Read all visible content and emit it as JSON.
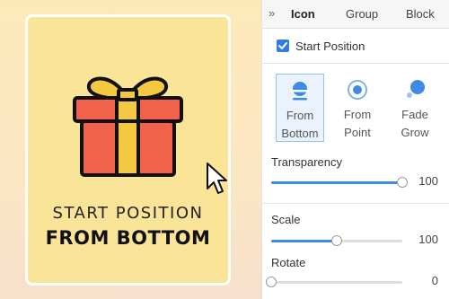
{
  "canvas": {
    "caption_line1": "START POSITION",
    "caption_line2": "FROM BOTTOM"
  },
  "panel": {
    "collapse_glyph": "»",
    "tabs": [
      {
        "label": "Icon",
        "active": true
      },
      {
        "label": "Group",
        "active": false
      },
      {
        "label": "Block",
        "active": false
      }
    ],
    "start_position": {
      "label": "Start Position",
      "checked": true
    },
    "options": [
      {
        "line1": "From",
        "line2": "Bottom",
        "icon": "from-bottom-icon",
        "selected": true
      },
      {
        "line1": "From",
        "line2": "Point",
        "icon": "from-point-icon",
        "selected": false
      },
      {
        "line1": "Fade",
        "line2": "Grow",
        "icon": "fade-grow-icon",
        "selected": false
      }
    ],
    "sliders": {
      "transparency": {
        "label": "Transparency",
        "value": "100",
        "fraction": 1.0
      },
      "scale": {
        "label": "Scale",
        "value": "100",
        "fraction": 0.5
      },
      "rotate": {
        "label": "Rotate",
        "value": "0",
        "fraction": 0.0
      }
    }
  },
  "colors": {
    "accent": "#3f8ae3",
    "gift_red": "#f2614c",
    "gift_yellow": "#f5c842",
    "card_bg": "#f9e498"
  }
}
